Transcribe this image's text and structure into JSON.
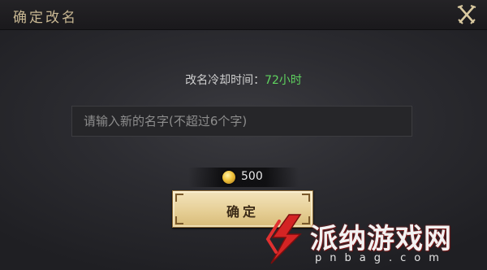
{
  "dialog": {
    "title": "确定改名",
    "close_icon": "close-crossed-swords-icon"
  },
  "cooldown": {
    "label": "改名冷却时间：",
    "value": "72小时",
    "value_color": "#5fd35f"
  },
  "name_input": {
    "value": "",
    "placeholder": "请输入新的名字(不超过6个字)"
  },
  "cost": {
    "icon": "gold-coin-icon",
    "amount": "500"
  },
  "confirm_button": {
    "label": "确定"
  },
  "watermark": {
    "text": "派纳游戏网",
    "url": "pnbag.com"
  }
}
